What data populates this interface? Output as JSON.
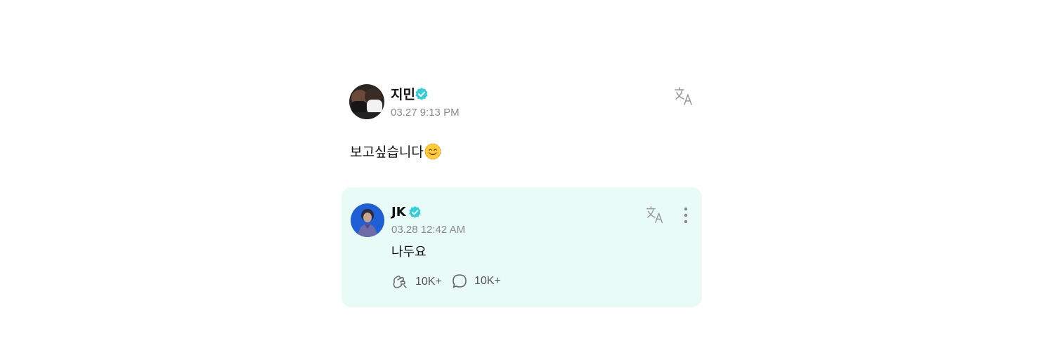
{
  "post": {
    "author": "지민",
    "timestamp": "03.27 9:13 PM",
    "text": "보고싶습니다",
    "emoji_icon": "smiling-face-emoji",
    "verified_color": "#2fd0d6"
  },
  "reply": {
    "author": "JK",
    "timestamp": "03.28 12:42 AM",
    "text": "나두요",
    "likes": "10K+",
    "comments": "10K+",
    "background": "#e8fbf7"
  },
  "icons": {
    "translate": "translate-icon",
    "more": "more-vertical-icon",
    "like": "like-hands-icon",
    "comment": "comment-bubble-icon",
    "verified": "verified-badge-icon"
  }
}
